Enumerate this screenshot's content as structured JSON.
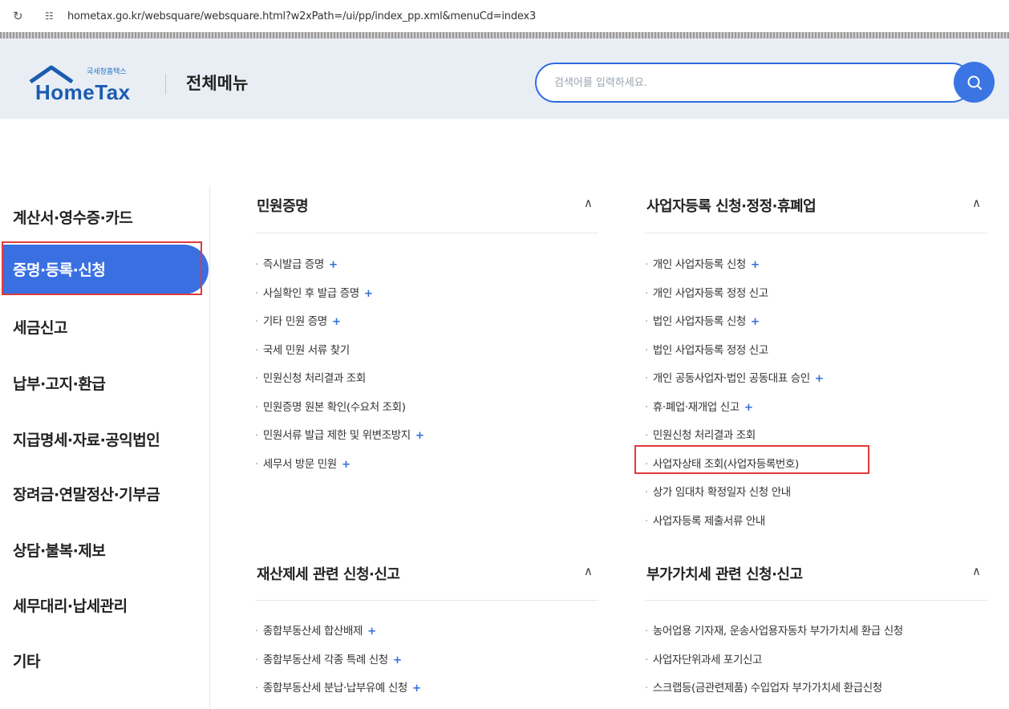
{
  "browser": {
    "url": "hometax.go.kr/websquare/websquare.html?w2xPath=/ui/pp/index_pp.xml&menuCd=index3"
  },
  "header": {
    "logo_small": "국세청홈택스",
    "logo_brand": "HomeTax",
    "menu_title": "전체메뉴",
    "search_placeholder": "검색어를 입력하세요."
  },
  "sidebar": {
    "items": [
      "계산서·영수증·카드",
      "증명·등록·신청",
      "세금신고",
      "납부·고지·환급",
      "지급명세·자료·공익법인",
      "장려금·연말정산·기부금",
      "상담·불복·제보",
      "세무대리·납세관리",
      "기타"
    ],
    "active_index": 1
  },
  "sections": {
    "civil": {
      "title": "민원증명",
      "items": [
        {
          "label": "즉시발급 증명",
          "plus": "+"
        },
        {
          "label": "사실확인 후 발급 증명",
          "plus": "+"
        },
        {
          "label": "기타 민원 증명",
          "plus": "+"
        },
        {
          "label": "국세 민원 서류 찾기"
        },
        {
          "label": "민원신청 처리결과 조회"
        },
        {
          "label": "민원증명 원본 확인(수요처 조회)"
        },
        {
          "label": "민원서류 발급 제한 및 위변조방지",
          "plus": "+"
        },
        {
          "label": "세무서 방문 민원",
          "plus": "+"
        }
      ]
    },
    "business": {
      "title": "사업자등록 신청·정정·휴폐업",
      "items": [
        {
          "label": "개인 사업자등록 신청",
          "plus": "+"
        },
        {
          "label": "개인 사업자등록 정정 신고"
        },
        {
          "label": "법인 사업자등록 신청",
          "plus": "+"
        },
        {
          "label": "법인 사업자등록 정정 신고"
        },
        {
          "label": "개인 공동사업자·법인 공동대표 승인",
          "plus": "+"
        },
        {
          "label": "휴·폐업·재개업 신고",
          "plus": "+"
        },
        {
          "label": "민원신청 처리결과 조회"
        },
        {
          "label": "사업자상태 조회(사업자등록번호)"
        },
        {
          "label": "상가 임대차 확정일자 신청 안내"
        },
        {
          "label": "사업자등록 제출서류 안내"
        }
      ]
    },
    "property": {
      "title": "재산제세 관련 신청·신고",
      "items": [
        {
          "label": "종합부동산세 합산배제",
          "plus": "+"
        },
        {
          "label": "종합부동산세 각종 특례 신청",
          "plus": "+"
        },
        {
          "label": "종합부동산세 분납·납부유예 신청",
          "plus": "+"
        }
      ]
    },
    "vat": {
      "title": "부가가치세 관련 신청·신고",
      "items": [
        {
          "label": "농어업용 기자재, 운송사업용자동차 부가가치세 환급 신청"
        },
        {
          "label": "사업자단위과세 포기신고"
        },
        {
          "label": "스크랩등(금관련제품) 수입업자 부가가치세 환급신청"
        }
      ]
    }
  },
  "icons": {
    "reload": "reload-icon",
    "site_info": "site-info-icon",
    "search": "search-icon",
    "chevron": "chevron-up-icon"
  },
  "colors": {
    "accent": "#3a6fe2",
    "highlight": "#e03a3a",
    "plus": "#2e6ed9"
  }
}
